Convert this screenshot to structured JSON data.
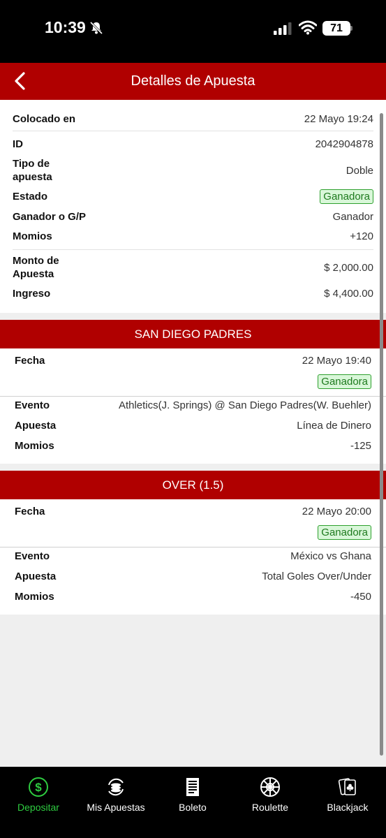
{
  "status_bar": {
    "time": "10:39",
    "battery": "71"
  },
  "header": {
    "title": "Detalles de Apuesta"
  },
  "summary": {
    "placed_label": "Colocado en",
    "placed_value": "22 Mayo 19:24",
    "id_label": "ID",
    "id_value": "2042904878",
    "type_label": "Tipo de apuesta",
    "type_value": "Doble",
    "status_label": "Estado",
    "status_value": "Ganadora",
    "winner_label": "Ganador o G/P",
    "winner_value": "Ganador",
    "odds_label": "Momios",
    "odds_value": "+120",
    "stake_label": "Monto de Apuesta",
    "stake_value": "$ 2,000.00",
    "income_label": "Ingreso",
    "income_value": "$ 4,400.00"
  },
  "legs": [
    {
      "title": "SAN DIEGO PADRES",
      "date_label": "Fecha",
      "date_value": "22 Mayo 19:40",
      "status": "Ganadora",
      "event_label": "Evento",
      "event_value": "Athletics(J. Springs) @ San Diego Padres(W. Buehler)",
      "bet_label": "Apuesta",
      "bet_value": "Línea de Dinero",
      "odds_label": "Momios",
      "odds_value": "-125"
    },
    {
      "title": "OVER (1.5)",
      "date_label": "Fecha",
      "date_value": "22 Mayo 20:00",
      "status": "Ganadora",
      "event_label": "Evento",
      "event_value": "México vs Ghana",
      "bet_label": "Apuesta",
      "bet_value": "Total Goles Over/Under",
      "odds_label": "Momios",
      "odds_value": "-450"
    }
  ],
  "nav": {
    "deposit": "Depositar",
    "my_bets": "Mis Apuestas",
    "ticket": "Boleto",
    "roulette": "Roulette",
    "blackjack": "Blackjack"
  },
  "colors": {
    "brand_red": "#b00000",
    "win_green": "#2ea02e",
    "active_nav": "#2ecc40"
  }
}
